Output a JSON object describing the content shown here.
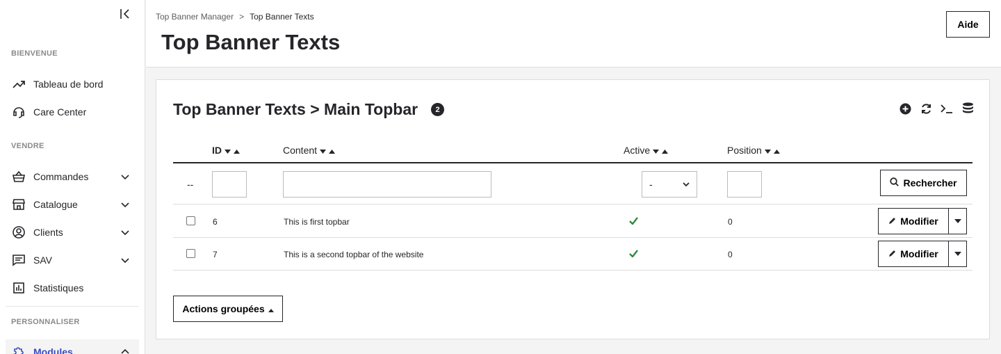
{
  "sidebar": {
    "sections": {
      "welcome": "BIENVENUE",
      "sell": "VENDRE",
      "customize": "PERSONNALISER"
    },
    "items": [
      {
        "label": "Tableau de bord",
        "icon": "trending-up-icon"
      },
      {
        "label": "Care Center",
        "icon": "headset-icon"
      },
      {
        "label": "Commandes",
        "icon": "basket-icon"
      },
      {
        "label": "Catalogue",
        "icon": "store-icon"
      },
      {
        "label": "Clients",
        "icon": "account-circle-icon"
      },
      {
        "label": "SAV",
        "icon": "chat-icon"
      },
      {
        "label": "Statistiques",
        "icon": "bar-chart-icon"
      },
      {
        "label": "Modules",
        "icon": "puzzle-icon"
      }
    ]
  },
  "header": {
    "breadcrumb": [
      "Top Banner Manager",
      ">",
      "Top Banner Texts"
    ],
    "title": "Top Banner Texts",
    "help_label": "Aide"
  },
  "panel": {
    "title": "Top Banner Texts > Main Topbar",
    "count": "2",
    "columns": {
      "id": "ID",
      "content": "Content",
      "active": "Active",
      "position": "Position"
    },
    "filter": {
      "dashes": "--",
      "active_selected": "-",
      "search_label": "Rechercher"
    },
    "rows": [
      {
        "id": "6",
        "content": "This is first topbar",
        "active": true,
        "position": "0"
      },
      {
        "id": "7",
        "content": "This is a second topbar of the website",
        "active": true,
        "position": "0"
      }
    ],
    "edit_label": "Modifier",
    "bulk_label": "Actions groupées"
  },
  "colors": {
    "accent": "#3b4cc0",
    "success": "#2e8b3d",
    "text": "#25252a"
  }
}
